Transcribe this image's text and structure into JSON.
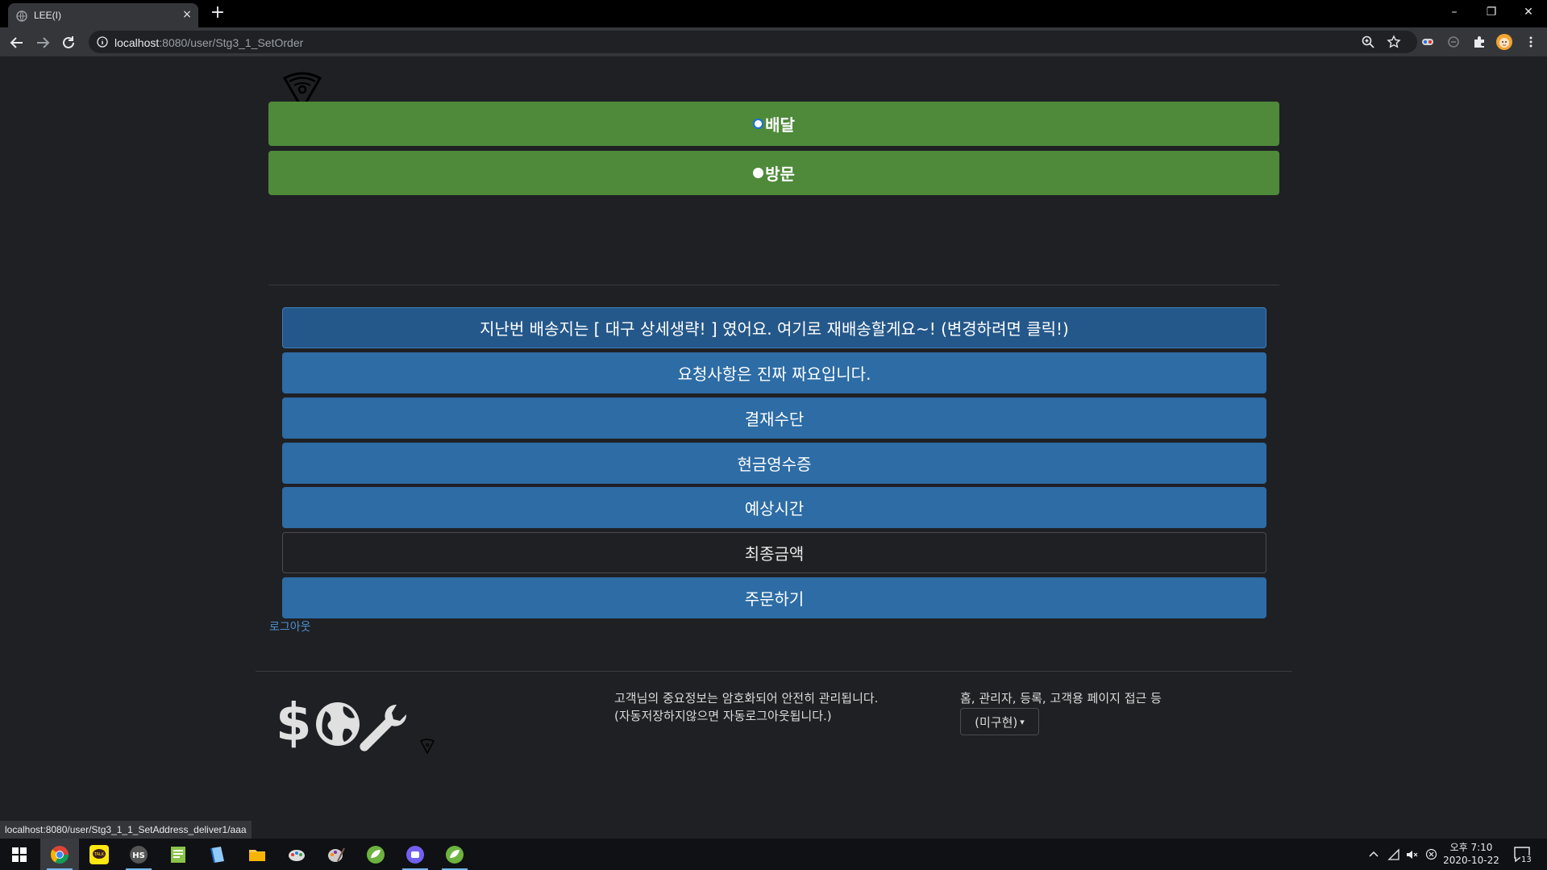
{
  "browser": {
    "tab_title": "LEE(I)",
    "tab_close": "×",
    "new_tab": "+",
    "url_host": "localhost",
    "url_rest": ":8080/user/Stg3_1_SetOrder",
    "status_url": "localhost:8080/user/Stg3_1_1_SetAddress_deliver1/aaa",
    "window_controls": [
      "–",
      "❐",
      "✕"
    ]
  },
  "order_type": {
    "delivery_label": "배달",
    "delivery_selected": false,
    "visit_label": "방문",
    "visit_selected": true
  },
  "order_rows": {
    "address": "지난번 배송지는 [ 대구 상세생략! ] 였어요. 여기로 재배송할게요~! (변경하려면 클릭!)",
    "request": "요청사항은 진짜 짜요입니다.",
    "payment": "결재수단",
    "receipt": "현금영수증",
    "eta": "예상시간",
    "total": "최종금액",
    "order": "주문하기"
  },
  "logout_label": "로그아웃",
  "footer": {
    "security_line1": "고객님의 중요정보는 암호화되어 안전히 관리됩니다.",
    "security_line2": "(자동저장하지않으면 자동로그아웃됩니다.)",
    "links_text": "홈, 관리자, 등록, 고객용 페이지 접근 등",
    "dropdown_label": "(미구현)",
    "dropdown_caret": "▾"
  },
  "taskbar": {
    "clock_time": "오후 7:10",
    "clock_date": "2020-10-22",
    "notification_count": "13",
    "apps": [
      "windows-start",
      "chrome",
      "kakaotalk",
      "hs",
      "notepad",
      "book",
      "file-explorer",
      "paint",
      "paint-2",
      "spring-tool",
      "viber",
      "spring-tool-2"
    ]
  },
  "colors": {
    "choice_green": "#4e8a3a",
    "row_blue": "#2d6ca5",
    "page_bg": "#1f2023",
    "link_blue": "#4d90d0"
  }
}
